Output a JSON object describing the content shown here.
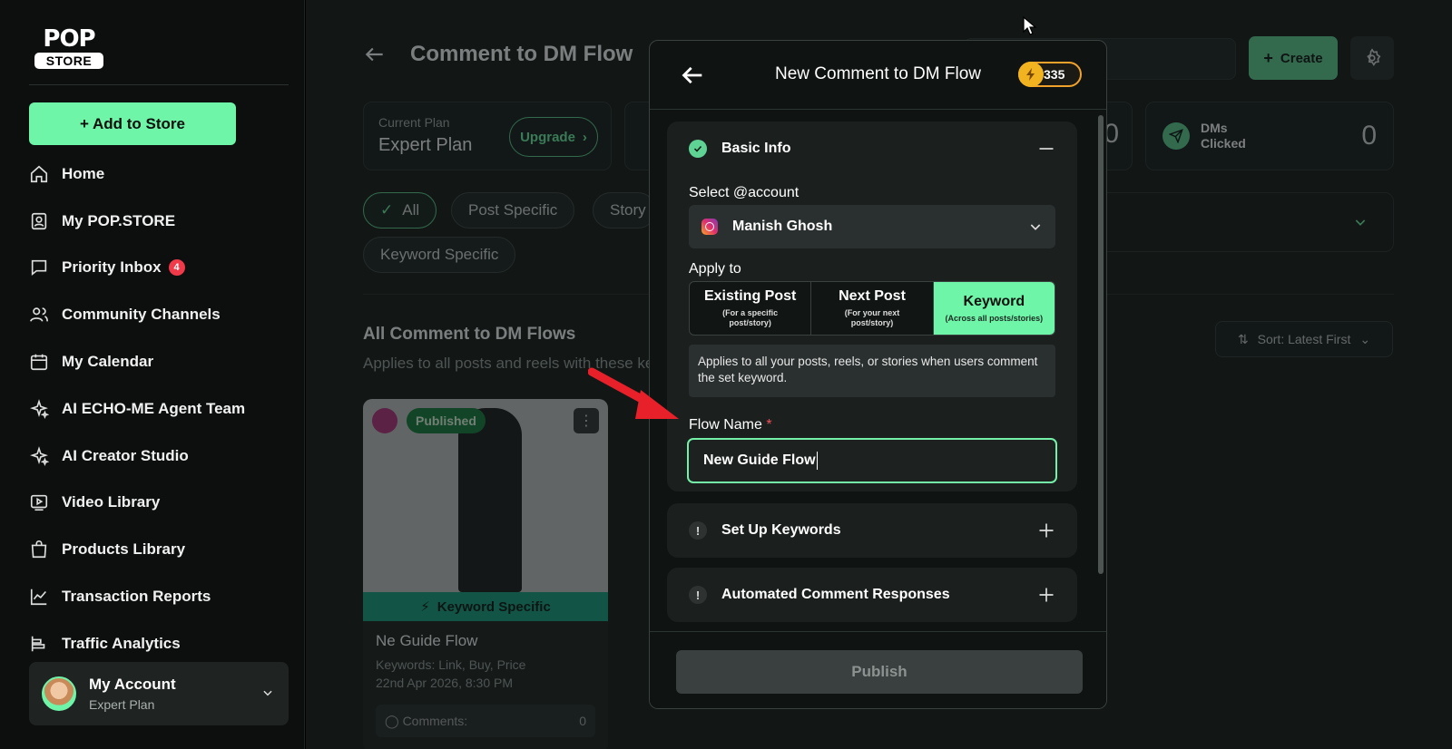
{
  "sidebar": {
    "logo_top": "POP",
    "logo_bottom": "STORE",
    "add_button": "+ Add to Store",
    "items": [
      {
        "label": "Home",
        "icon": "home-icon"
      },
      {
        "label": "My POP.STORE",
        "icon": "profile-card-icon"
      },
      {
        "label": "Priority Inbox",
        "icon": "chat-icon",
        "badge": "4"
      },
      {
        "label": "Community Channels",
        "icon": "users-icon"
      },
      {
        "label": "My Calendar",
        "icon": "calendar-icon"
      },
      {
        "label": "AI ECHO-ME Agent Team",
        "icon": "sparkle-icon"
      },
      {
        "label": "AI Creator Studio",
        "icon": "sparkle-icon"
      },
      {
        "label": "Video Library",
        "icon": "video-icon"
      },
      {
        "label": "Products Library",
        "icon": "bag-icon"
      },
      {
        "label": "Transaction Reports",
        "icon": "chart-line-icon"
      },
      {
        "label": "Traffic Analytics",
        "icon": "bar-chart-icon"
      }
    ],
    "account": {
      "name": "My Account",
      "plan": "Expert Plan"
    }
  },
  "main": {
    "title": "Comment to DM Flow",
    "create_label": "Create",
    "plan_card": {
      "label": "Current Plan",
      "plan": "Expert Plan",
      "upgrade": "Upgrade"
    },
    "stat_partial_value": "0",
    "dm_stat": {
      "label_line1": "DMs",
      "label_line2": "Clicked",
      "value": "0"
    },
    "filters": [
      "All",
      "Post Specific",
      "Story",
      "Keyword Specific"
    ],
    "section_title": "All Comment to DM Flows",
    "section_subtitle": "Applies to all posts and reels with these ke",
    "sort_label": "Sort: Latest First",
    "flow_card": {
      "status": "Published",
      "type": "Keyword Specific",
      "name": "Ne Guide Flow",
      "keywords": "Keywords: Link, Buy, Price",
      "date": "22nd Apr 2026, 8:30 PM",
      "comments_label": "Comments:",
      "comments_value": "0"
    }
  },
  "modal": {
    "title": "New Comment to DM Flow",
    "coins": "335",
    "basic_info": {
      "title": "Basic Info",
      "account_label": "Select @account",
      "account_value": "Manish Ghosh",
      "apply_label": "Apply to",
      "options": [
        {
          "label": "Existing Post",
          "sub": "(For a specific post/story)"
        },
        {
          "label": "Next Post",
          "sub": "(For your next post/story)"
        },
        {
          "label": "Keyword",
          "sub": "(Across all posts/stories)"
        }
      ],
      "selected_option": "Keyword",
      "helper": "Applies to all your posts, reels, or stories when users comment the set keyword.",
      "flow_name_label": "Flow Name",
      "required_mark": "*",
      "flow_name_value": "New Guide Flow"
    },
    "keywords_section": "Set Up Keywords",
    "responses_section": "Automated Comment Responses",
    "publish": "Publish"
  },
  "colors": {
    "accent": "#6ff5a8",
    "badge": "#f03a4a",
    "coin": "#f2b321",
    "arrow": "#e8202a"
  }
}
